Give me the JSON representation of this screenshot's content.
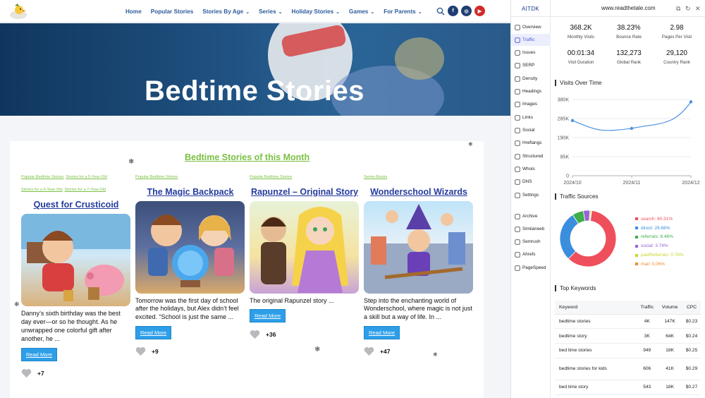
{
  "site": {
    "nav": [
      {
        "label": "Home",
        "dropdown": false
      },
      {
        "label": "Popular Stories",
        "dropdown": false
      },
      {
        "label": "Stories By Age",
        "dropdown": true
      },
      {
        "label": "Series",
        "dropdown": true
      },
      {
        "label": "Holiday Stories",
        "dropdown": true
      },
      {
        "label": "Games",
        "dropdown": true
      },
      {
        "label": "For Parents",
        "dropdown": true
      }
    ],
    "social_icons": [
      "facebook-icon",
      "instagram-icon",
      "youtube-icon"
    ],
    "hero_title": "Bedtime Stories",
    "month_heading": "Bedtime Stories of this Month",
    "read_more_label": "Read More",
    "cards": [
      {
        "tags": [
          "Popular Bedtime Stories",
          "Stories for a 5-Year-Old",
          "Stories for a 6-Year-Old",
          "Stories for a 7-Year-Old"
        ],
        "title": "Quest for Crusticoid",
        "excerpt": "Danny’s sixth birthday was the best day ever—or so he thought. As he unwrapped one colorful gift after another, he ...",
        "likes": "+7"
      },
      {
        "tags": [
          "Popular Bedtime Stories"
        ],
        "title": "The Magic Backpack",
        "excerpt": "Tomorrow was the first day of school after the holidays, but Alex didn’t feel excited. “School is just the same ...",
        "likes": "+9"
      },
      {
        "tags": [
          "Popular Bedtime Stories"
        ],
        "title": "Rapunzel – Original Story",
        "excerpt": "The original Rapunzel story ...",
        "likes": "+36"
      },
      {
        "tags": [
          "Series-Books"
        ],
        "title": "Wonderschool Wizards",
        "excerpt": "Step into the enchanting world of Wonderschool, where magic is not just a skill but a way of life. In ...",
        "likes": "+47"
      }
    ]
  },
  "extension": {
    "brand": "AITDK",
    "domain": "www.readthetale.com",
    "sidebar": [
      {
        "label": "Overview",
        "icon": "overview-icon"
      },
      {
        "label": "Traffic",
        "icon": "traffic-icon",
        "active": true
      },
      {
        "label": "Issues",
        "icon": "warning-icon"
      },
      {
        "label": "SERP",
        "icon": "serp-icon"
      },
      {
        "label": "Density",
        "icon": "density-icon"
      },
      {
        "label": "Headings",
        "icon": "heading-icon"
      },
      {
        "label": "Images",
        "icon": "image-icon"
      },
      {
        "label": "Links",
        "icon": "link-icon"
      },
      {
        "label": "Social",
        "icon": "share-icon"
      },
      {
        "label": "Hreflangs",
        "icon": "globe-icon"
      },
      {
        "label": "Structured",
        "icon": "code-icon"
      },
      {
        "label": "Whois",
        "icon": "person-icon"
      },
      {
        "label": "DNS",
        "icon": "dns-icon"
      },
      {
        "label": "Settings",
        "icon": "gear-icon"
      },
      {
        "label": "Archive",
        "icon": "archive-icon"
      },
      {
        "label": "Similarweb",
        "icon": "similarweb-icon"
      },
      {
        "label": "Semrush",
        "icon": "semrush-icon"
      },
      {
        "label": "Ahrefs",
        "icon": "ahrefs-icon"
      },
      {
        "label": "PageSpeed",
        "icon": "pagespeed-icon"
      }
    ],
    "metrics": [
      {
        "value": "368.2K",
        "label": "Monthly Visits"
      },
      {
        "value": "38.23%",
        "label": "Bounce Rate"
      },
      {
        "value": "2.98",
        "label": "Pages Per Visit"
      },
      {
        "value": "00:01:34",
        "label": "Visit Duration"
      },
      {
        "value": "132,273",
        "label": "Global Rank"
      },
      {
        "value": "29,120",
        "label": "Country Rank"
      }
    ],
    "visits_title": "Visits Over Time",
    "sources_title": "Traffic Sources",
    "keywords_title": "Top Keywords",
    "keywords_table": {
      "headers": [
        "Keyword",
        "Traffic",
        "Volume",
        "CPC"
      ],
      "rows": [
        [
          "bedtime stories",
          "4K",
          "147K",
          "$0.23"
        ],
        [
          "bedtime story",
          "3K",
          "64K",
          "$0.24"
        ],
        [
          "bed time stories",
          "949",
          "18K",
          "$0.25"
        ],
        [
          "bedtime stories for kids",
          "606",
          "41K",
          "$0.29"
        ],
        [
          "bed time story",
          "543",
          "18K",
          "$0.27"
        ]
      ]
    }
  },
  "chart_data": [
    {
      "type": "line",
      "title": "Visits Over Time",
      "x": [
        "2024/10",
        "2024/11",
        "2024/12"
      ],
      "values": [
        275000,
        236000,
        368200
      ],
      "yticks": [
        "0",
        "95K",
        "190K",
        "285K",
        "380K"
      ],
      "ylim": [
        0,
        380000
      ],
      "grid": true,
      "color": "#4a90e2"
    },
    {
      "type": "pie",
      "title": "Traffic Sources",
      "slices": [
        {
          "name": "search",
          "label": "search: 60.31%",
          "value": 60.31,
          "color": "#ef4e5b"
        },
        {
          "name": "direct",
          "label": "direct: 28.66%",
          "value": 28.66,
          "color": "#3b8ede"
        },
        {
          "name": "referrals",
          "label": "referrals: 6.46%",
          "value": 6.46,
          "color": "#3fae49"
        },
        {
          "name": "social",
          "label": "social: 3.74%",
          "value": 3.74,
          "color": "#9a62d8"
        },
        {
          "name": "paidReferrals",
          "label": "paidReferrals: 0.76%",
          "value": 0.76,
          "color": "#c8d62f"
        },
        {
          "name": "mail",
          "label": "mail: 0.06%",
          "value": 0.06,
          "color": "#f18a2c"
        }
      ],
      "legend": "right"
    }
  ]
}
